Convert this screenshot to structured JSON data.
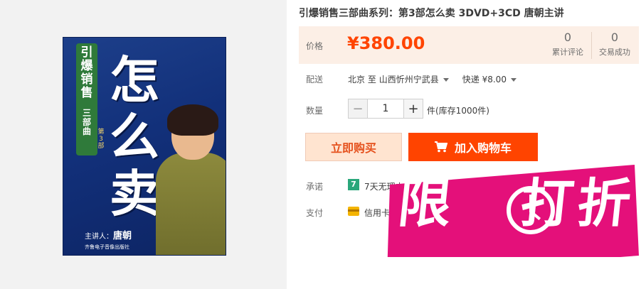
{
  "product": {
    "title": "引爆销售三部曲系列：第3部怎么卖 3DVD+3CD 唐朝主讲",
    "image": {
      "series": "引爆销售",
      "series_sub": "三部曲",
      "part": "第3部",
      "main_title": "怎么卖",
      "presenter_label": "主讲人：",
      "presenter_name": "唐朝",
      "publisher": "齐鲁电子音像出版社"
    }
  },
  "price": {
    "label": "价格",
    "value": "¥380.00"
  },
  "stats": {
    "reviews_count": "0",
    "reviews_label": "累计评论",
    "deals_count": "0",
    "deals_label": "交易成功"
  },
  "shipping": {
    "label": "配送",
    "from": "北京",
    "to_word": "至",
    "destination": "山西忻州宁武县",
    "express": "快递 ¥8.00"
  },
  "quantity": {
    "label": "数量",
    "value": "1",
    "minus": "−",
    "plus": "+",
    "stock": "件(库存1000件)"
  },
  "actions": {
    "buy_now": "立即购买",
    "add_to_cart": "加入购物车"
  },
  "promise": {
    "label": "承诺",
    "badge": "7",
    "text": "7天无理由"
  },
  "payment": {
    "label": "支付",
    "text": "信用卡"
  },
  "promo": {
    "text_1": "限",
    "text_2": "打折",
    "color": "#e4107a"
  },
  "colors": {
    "accent": "#ff4400",
    "price_bg": "#fcefe6"
  }
}
